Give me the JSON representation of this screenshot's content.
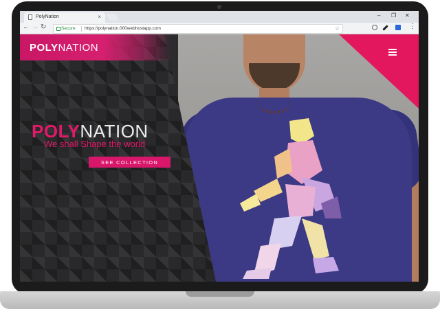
{
  "browser": {
    "tab_title": "PolyNation",
    "tab_close": "×",
    "secure_label": "Secure",
    "url": "https://polynation.000webhostapp.com",
    "window_controls": [
      "–",
      "❐",
      "✕"
    ]
  },
  "site": {
    "header_logo_bold": "POLY",
    "header_logo_light": "NATION",
    "hero_logo_bold": "POLY",
    "hero_logo_light": "NATION",
    "tagline": "We shall Shape the world",
    "cta_label": "SEE COLLECTION"
  },
  "colors": {
    "brand_pink": "#e01a6a",
    "shirt_navy": "#3c3a85",
    "pattern_dark": "#29292b"
  }
}
